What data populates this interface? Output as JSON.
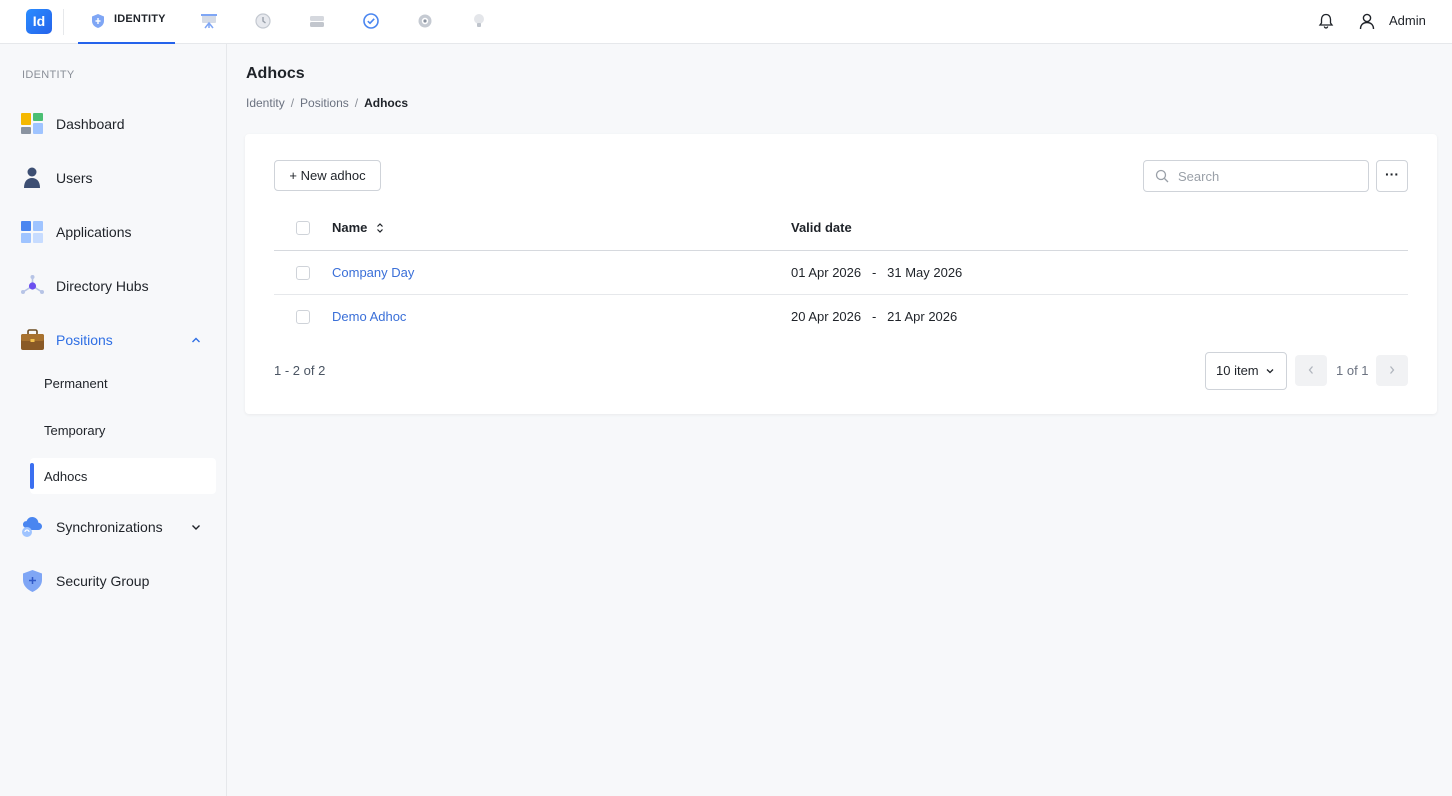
{
  "app": {
    "logo_text": "Id",
    "module_tab_label": "IDENTITY",
    "module_icons": [
      "presentation-icon",
      "history-icon",
      "storage-icon",
      "check-badge-icon",
      "settings-icon",
      "lightbulb-icon"
    ],
    "user_name": "Admin",
    "accent_color": "#2563eb"
  },
  "sidebar": {
    "section_label": "IDENTITY",
    "items": [
      {
        "label": "Dashboard",
        "icon": "dashboard-icon"
      },
      {
        "label": "Users",
        "icon": "user-icon"
      },
      {
        "label": "Applications",
        "icon": "applications-icon"
      },
      {
        "label": "Directory Hubs",
        "icon": "hub-icon"
      },
      {
        "label": "Positions",
        "icon": "briefcase-icon",
        "expanded": true
      },
      {
        "label": "Synchronizations",
        "icon": "cloud-sync-icon",
        "expanded": false
      },
      {
        "label": "Security Group",
        "icon": "shield-icon"
      }
    ],
    "positions_children": [
      {
        "label": "Permanent"
      },
      {
        "label": "Temporary"
      },
      {
        "label": "Adhocs",
        "active": true
      }
    ]
  },
  "page": {
    "title": "Adhocs",
    "breadcrumb": [
      "Identity",
      "Positions",
      "Adhocs"
    ],
    "breadcrumb_separator": "/",
    "new_button_label": "+ New adhoc",
    "search_placeholder": "Search",
    "more_button_label": "···"
  },
  "table": {
    "columns": [
      "Name",
      "Valid date"
    ],
    "rows": [
      {
        "name": "Company Day",
        "valid_date": "01 Apr 2026   -   31 May 2026"
      },
      {
        "name": "Demo Adhoc",
        "valid_date": "20 Apr 2026   -   21 Apr 2026"
      }
    ]
  },
  "pagination": {
    "range_text": "1 - 2 of 2",
    "page_size": "10 item",
    "page_label": "1 of 1"
  }
}
